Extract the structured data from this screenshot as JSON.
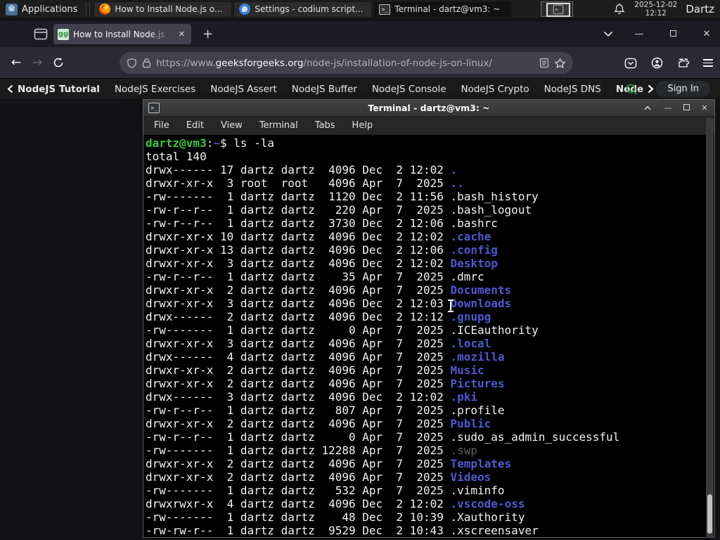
{
  "panel": {
    "applications_label": "Applications",
    "windows": [
      {
        "icon": "firefox-icon",
        "label": "How to Install Node.js o..."
      },
      {
        "icon": "vscodium-icon",
        "label": "Settings - codium script..."
      },
      {
        "icon": "terminal-icon",
        "label": "Terminal - dartz@vm3: ~"
      }
    ],
    "clock_date": "2025-12-02",
    "clock_time": "12:12",
    "username": "Dartz"
  },
  "browser": {
    "tab": {
      "title": "How to Install Node.js on",
      "close": "✕"
    },
    "new_tab": "+",
    "window_controls": {
      "minimize": "—",
      "close": "✕"
    },
    "url": {
      "scheme": "https://www.",
      "domain": "geeksforgeeks.org",
      "path": "/node-js/installation-of-node-js-on-linux/"
    },
    "site_nav": {
      "links": [
        "NodeJS Tutorial",
        "NodeJS Exercises",
        "NodeJS Assert",
        "NodeJS Buffer",
        "NodeJS Console",
        "NodeJS Crypto",
        "NodeJS DNS",
        "Node"
      ],
      "sign_in": "Sign In"
    }
  },
  "terminal": {
    "title": "Terminal - dartz@vm3: ~",
    "menus": [
      "File",
      "Edit",
      "View",
      "Terminal",
      "Tabs",
      "Help"
    ],
    "window_controls": {
      "shade": "⌃",
      "minimize": "—",
      "close": "✕"
    },
    "prompt": {
      "userhost": "dartz@vm3",
      "sep": ":",
      "path": "~",
      "rest": "$ ls -la"
    },
    "total_line": "total 140",
    "ls": [
      [
        "drwx------ 17 dartz dartz  4096 Dec  2 12:02 ",
        ".",
        "dir"
      ],
      [
        "drwxr-xr-x  3 root  root   4096 Apr  7  2025 ",
        "..",
        "dir"
      ],
      [
        "-rw-------  1 dartz dartz  1120 Dec  2 11:56 ",
        ".bash_history",
        "file"
      ],
      [
        "-rw-r--r--  1 dartz dartz   220 Apr  7  2025 ",
        ".bash_logout",
        "file"
      ],
      [
        "-rw-r--r--  1 dartz dartz  3730 Dec  2 12:06 ",
        ".bashrc",
        "file"
      ],
      [
        "drwxr-xr-x 10 dartz dartz  4096 Dec  2 12:02 ",
        ".cache",
        "dir"
      ],
      [
        "drwxr-xr-x 13 dartz dartz  4096 Dec  2 12:06 ",
        ".config",
        "dir"
      ],
      [
        "drwxr-xr-x  3 dartz dartz  4096 Dec  2 12:02 ",
        "Desktop",
        "dir"
      ],
      [
        "-rw-r--r--  1 dartz dartz    35 Apr  7  2025 ",
        ".dmrc",
        "file"
      ],
      [
        "drwxr-xr-x  2 dartz dartz  4096 Apr  7  2025 ",
        "Documents",
        "dir"
      ],
      [
        "drwxr-xr-x  3 dartz dartz  4096 Dec  2 12:03 ",
        "Downloads",
        "dir"
      ],
      [
        "drwx------  2 dartz dartz  4096 Dec  2 12:12 ",
        ".gnupg",
        "dir"
      ],
      [
        "-rw-------  1 dartz dartz     0 Apr  7  2025 ",
        ".ICEauthority",
        "file"
      ],
      [
        "drwxr-xr-x  3 dartz dartz  4096 Apr  7  2025 ",
        ".local",
        "dir"
      ],
      [
        "drwx------  4 dartz dartz  4096 Apr  7  2025 ",
        ".mozilla",
        "dir"
      ],
      [
        "drwxr-xr-x  2 dartz dartz  4096 Apr  7  2025 ",
        "Music",
        "dir"
      ],
      [
        "drwxr-xr-x  2 dartz dartz  4096 Apr  7  2025 ",
        "Pictures",
        "dir"
      ],
      [
        "drwx------  3 dartz dartz  4096 Dec  2 12:02 ",
        ".pki",
        "dir"
      ],
      [
        "-rw-r--r--  1 dartz dartz   807 Apr  7  2025 ",
        ".profile",
        "file"
      ],
      [
        "drwxr-xr-x  2 dartz dartz  4096 Apr  7  2025 ",
        "Public",
        "dir"
      ],
      [
        "-rw-r--r--  1 dartz dartz     0 Apr  7  2025 ",
        ".sudo_as_admin_successful",
        "file"
      ],
      [
        "-rw-------  1 dartz dartz 12288 Apr  7  2025 ",
        ".swp",
        "dim"
      ],
      [
        "drwxr-xr-x  2 dartz dartz  4096 Apr  7  2025 ",
        "Templates",
        "dir"
      ],
      [
        "drwxr-xr-x  2 dartz dartz  4096 Apr  7  2025 ",
        "Videos",
        "dir"
      ],
      [
        "-rw-------  1 dartz dartz   532 Apr  7  2025 ",
        ".viminfo",
        "file"
      ],
      [
        "drwxrwxr-x  4 dartz dartz  4096 Dec  2 12:02 ",
        ".vscode-oss",
        "dir"
      ],
      [
        "-rw-------  1 dartz dartz    48 Dec  2 10:39 ",
        ".Xauthority",
        "file"
      ],
      [
        "-rw-rw-r--  1 dartz dartz  9529 Dec  2 10:43 ",
        ".xscreensaver",
        "file"
      ]
    ]
  },
  "colors": {
    "terminal_green": "#3cc83c",
    "terminal_blue": "#5059cf",
    "terminal_dim": "#5f5f5f",
    "gfg_green": "#2f8d46",
    "panel_bg": "#1d1d1d",
    "toolbar_bg": "#2b2a33",
    "tab_bg": "#42414d"
  }
}
